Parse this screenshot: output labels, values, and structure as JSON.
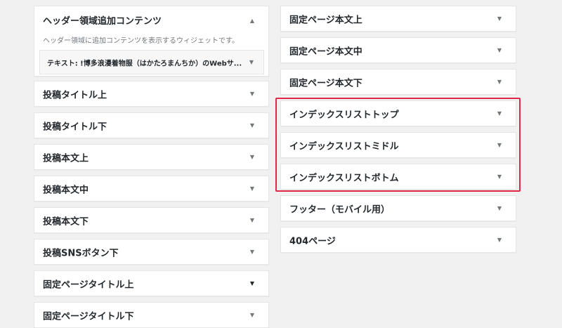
{
  "left_column": {
    "expanded_area": {
      "title": "ヘッダー領域追加コンテンツ",
      "description": "ヘッダー領域に追加コンテンツを表示するウィジェットです。",
      "widget": {
        "title": "テキスト: !博多浪漫着物服（はかたろまんちか）のWebサ..."
      }
    },
    "areas": [
      {
        "title": "投稿タイトル上"
      },
      {
        "title": "投稿タイトル下"
      },
      {
        "title": "投稿本文上"
      },
      {
        "title": "投稿本文中"
      },
      {
        "title": "投稿本文下"
      },
      {
        "title": "投稿SNSボタン下"
      },
      {
        "title": "固定ページタイトル上"
      },
      {
        "title": "固定ページタイトル下"
      }
    ]
  },
  "right_column": {
    "areas": [
      {
        "title": "固定ページ本文上"
      },
      {
        "title": "固定ページ本文中"
      },
      {
        "title": "固定ページ本文下"
      },
      {
        "title": "インデックスリストトップ"
      },
      {
        "title": "インデックスリストミドル"
      },
      {
        "title": "インデックスリストボトム"
      },
      {
        "title": "フッター（モバイル用）"
      },
      {
        "title": "404ページ"
      }
    ]
  },
  "icons": {
    "collapse": "▲",
    "expand": "▼"
  },
  "colors": {
    "highlight": "#e0284a",
    "panel_bg": "#ffffff",
    "page_bg": "#f1f1f1"
  }
}
